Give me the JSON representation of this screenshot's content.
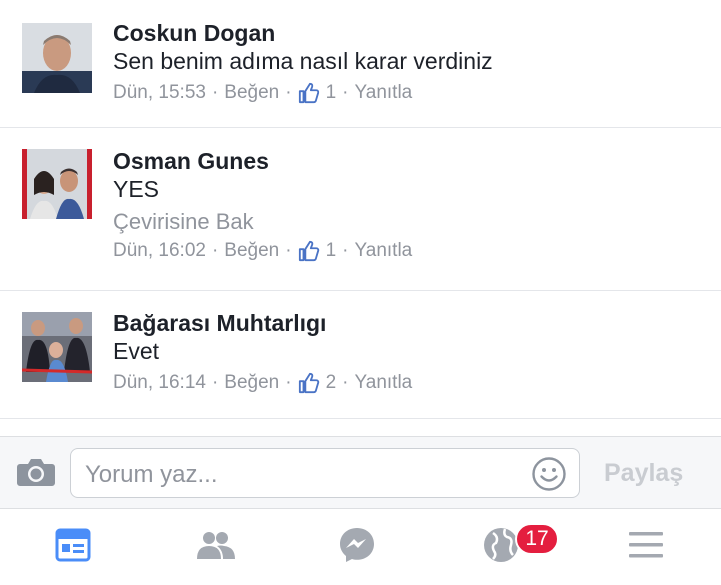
{
  "comments": [
    {
      "name": "Coskun Dogan",
      "text": "Sen benim adıma nasıl karar verdiniz",
      "time": "Dün, 15:53",
      "like_label": "Beğen",
      "like_count": "1",
      "reply_label": "Yanıtla",
      "separator": "·"
    },
    {
      "name": "Osman Gunes",
      "text": "YES",
      "translate_label": "Çevirisine Bak",
      "time": "Dün, 16:02",
      "like_label": "Beğen",
      "like_count": "1",
      "reply_label": "Yanıtla",
      "separator": "·"
    },
    {
      "name": "Bağarası Muhtarlıgı",
      "text": "Evet",
      "time": "Dün, 16:14",
      "like_label": "Beğen",
      "like_count": "2",
      "reply_label": "Yanıtla",
      "separator": "·"
    }
  ],
  "composer": {
    "placeholder": "Yorum yaz...",
    "share_label": "Paylaş",
    "camera_icon": "camera-icon",
    "emoji_icon": "smiley-icon"
  },
  "tabbar": {
    "items": [
      {
        "icon": "news-feed-icon",
        "active": true
      },
      {
        "icon": "friends-icon",
        "active": false
      },
      {
        "icon": "messenger-icon",
        "active": false
      },
      {
        "icon": "notifications-globe-icon",
        "active": false,
        "badge": "17"
      },
      {
        "icon": "menu-icon",
        "active": false
      }
    ]
  },
  "colors": {
    "active_tab": "#4a8df8",
    "inactive_tab": "#a4a9b1",
    "badge": "#e41e3f",
    "meta_text": "#90949c"
  }
}
